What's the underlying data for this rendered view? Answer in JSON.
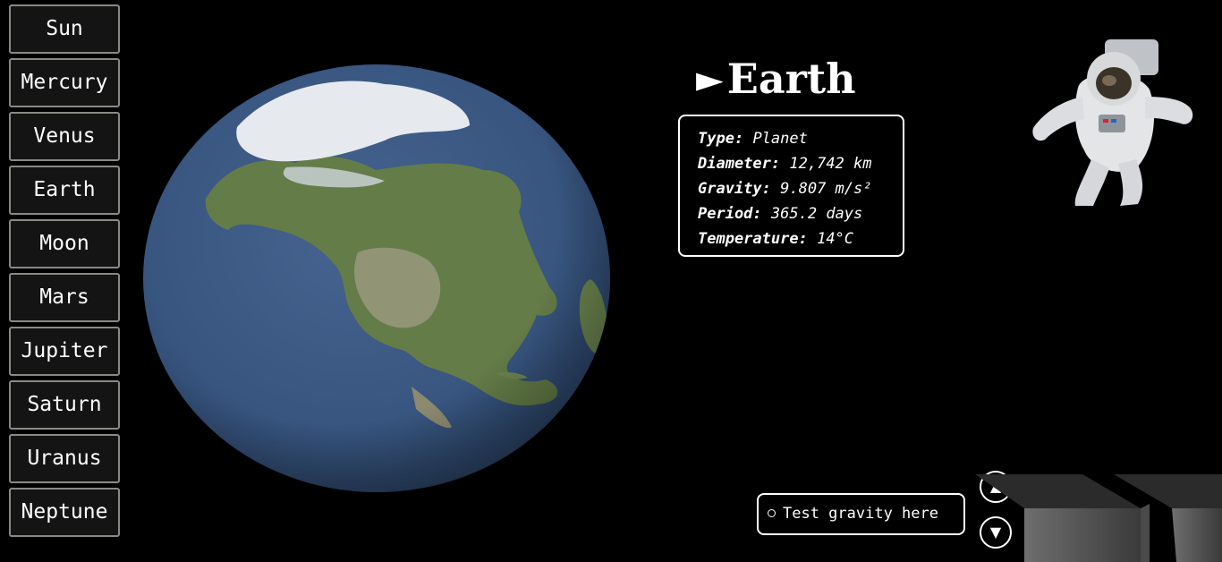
{
  "sidebar": {
    "items": [
      {
        "label": "Sun"
      },
      {
        "label": "Mercury"
      },
      {
        "label": "Venus"
      },
      {
        "label": "Earth"
      },
      {
        "label": "Moon"
      },
      {
        "label": "Mars"
      },
      {
        "label": "Jupiter"
      },
      {
        "label": "Saturn"
      },
      {
        "label": "Uranus"
      },
      {
        "label": "Neptune"
      }
    ]
  },
  "body": {
    "title_arrow": "►",
    "title": "Earth",
    "info": [
      {
        "key": "Type:",
        "value": "Planet"
      },
      {
        "key": "Diameter:",
        "value": "12,742 km"
      },
      {
        "key": "Gravity:",
        "value": "9.807 m/s²"
      },
      {
        "key": "Period:",
        "value": "365.2 days"
      },
      {
        "key": "Temperature:",
        "value": "14°C"
      }
    ]
  },
  "controls": {
    "gravity_label": "Test gravity here",
    "up_glyph": "▲",
    "down_glyph": "▼"
  },
  "icons": {
    "planet": "earth-globe",
    "astronaut": "astronaut-figure",
    "gravity_radio": "radio-circle"
  },
  "colors": {
    "background": "#000000",
    "button_bg": "#141414",
    "button_border": "#8a8a84",
    "ocean": "#37557f",
    "land": "#5f7a45"
  }
}
